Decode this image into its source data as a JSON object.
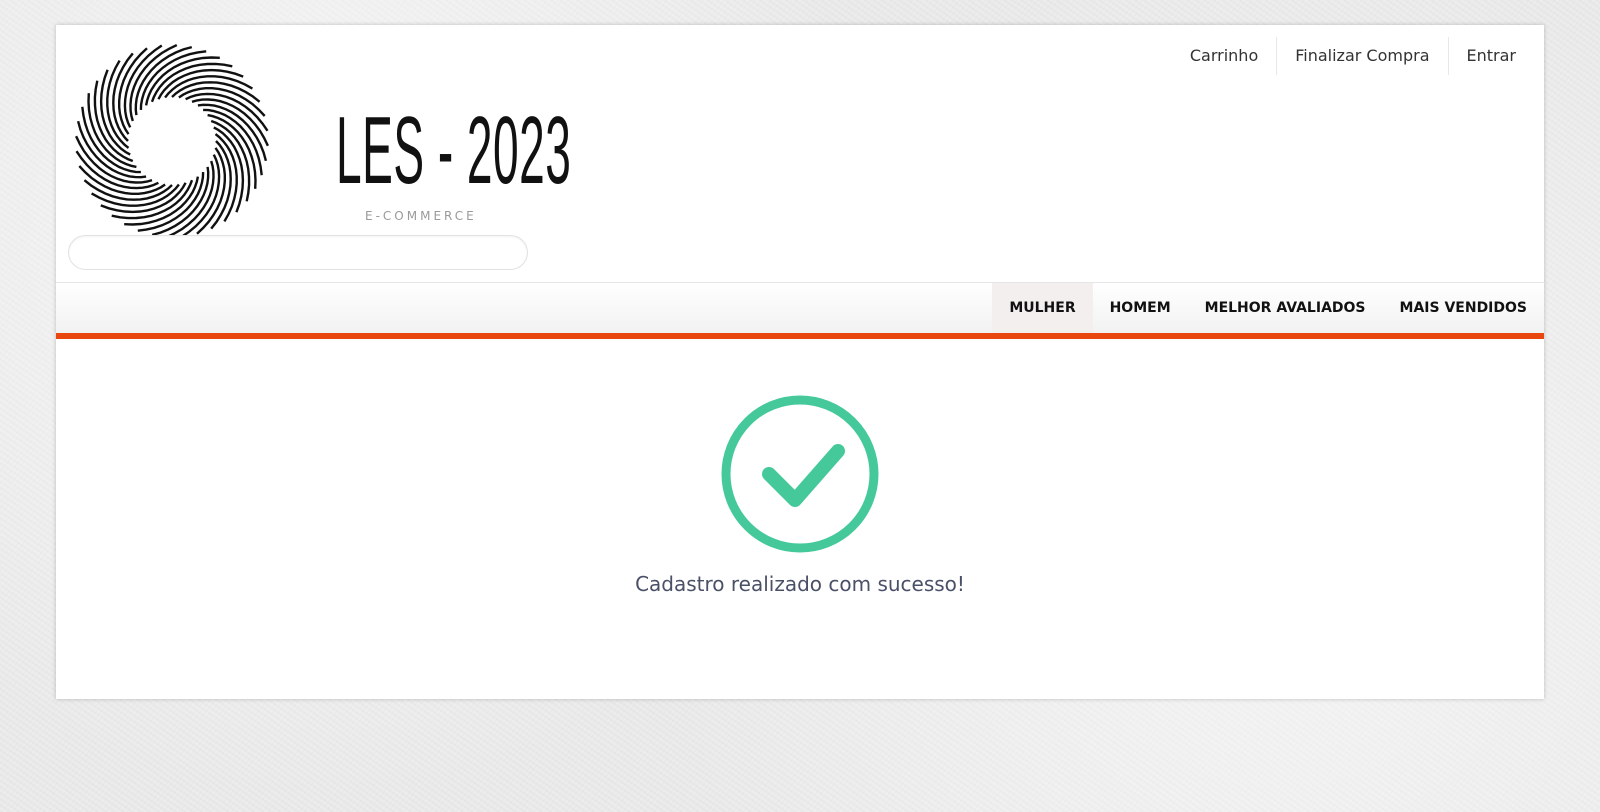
{
  "header": {
    "logo_title": "LES - 2023",
    "logo_subtitle": "E-COMMERCE",
    "search_placeholder": ""
  },
  "top_links": {
    "cart": "Carrinho",
    "checkout": "Finalizar Compra",
    "login": "Entrar"
  },
  "nav": {
    "items": [
      "MULHER",
      "HOMEM",
      "MELHOR AVALIADOS",
      "MAIS VENDIDOS"
    ],
    "active": "MULHER"
  },
  "main": {
    "success_message": "Cadastro realizado com sucesso!"
  },
  "colors": {
    "accent": "#e8470f",
    "success": "#45c99a",
    "message_text": "#4a5068"
  },
  "icons": {
    "logo": "spiral-logo-icon",
    "success": "check-circle-icon"
  }
}
